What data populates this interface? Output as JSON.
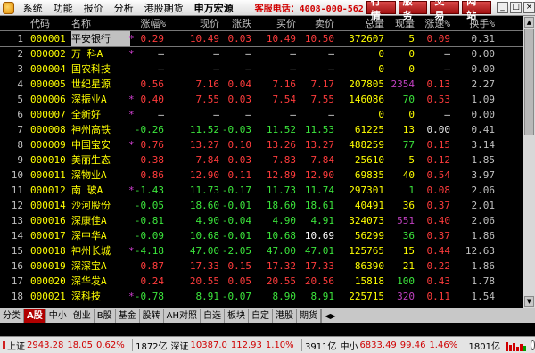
{
  "menubar": {
    "items": [
      "系统",
      "功能",
      "报价",
      "分析",
      "港股期货",
      "申万宏源"
    ],
    "hotline": "客服电话：4008-000-562",
    "buttons": [
      "行 情",
      "服 务",
      "交 易",
      "网 站"
    ]
  },
  "table": {
    "headers": [
      "代码",
      "名称",
      "涨幅%",
      "现价",
      "涨跌",
      "买价",
      "卖价",
      "总量",
      "现量",
      "涨速%",
      "换手%"
    ],
    "rows": [
      {
        "idx": "1",
        "code": "000001",
        "name": "平安银行",
        "star": "*",
        "pct": "0.29",
        "price": "10.49",
        "chg": "0.03",
        "bid": "10.49",
        "ask": "10.50",
        "vol": "372607",
        "cur": "5",
        "spd": "0.09",
        "turn": "0.31"
      },
      {
        "idx": "2",
        "code": "000002",
        "name": "万  科A",
        "star": "*",
        "pct": "—",
        "price": "—",
        "chg": "—",
        "bid": "—",
        "ask": "—",
        "vol": "0",
        "cur": "0",
        "spd": "—",
        "turn": "0.00"
      },
      {
        "idx": "3",
        "code": "000004",
        "name": "国农科技",
        "star": "",
        "pct": "—",
        "price": "—",
        "chg": "—",
        "bid": "—",
        "ask": "—",
        "vol": "0",
        "cur": "0",
        "spd": "—",
        "turn": "0.00"
      },
      {
        "idx": "4",
        "code": "000005",
        "name": "世纪星源",
        "star": "",
        "pct": "0.56",
        "price": "7.16",
        "chg": "0.04",
        "bid": "7.16",
        "ask": "7.17",
        "vol": "207805",
        "cur": "2354",
        "spd": "0.13",
        "turn": "2.27"
      },
      {
        "idx": "5",
        "code": "000006",
        "name": "深振业A",
        "star": "*",
        "pct": "0.40",
        "price": "7.55",
        "chg": "0.03",
        "bid": "7.54",
        "ask": "7.55",
        "vol": "146086",
        "cur": "70",
        "spd": "0.53",
        "turn": "1.09"
      },
      {
        "idx": "6",
        "code": "000007",
        "name": "全新好",
        "star": "*",
        "pct": "—",
        "price": "—",
        "chg": "—",
        "bid": "—",
        "ask": "—",
        "vol": "0",
        "cur": "0",
        "spd": "—",
        "turn": "0.00"
      },
      {
        "idx": "7",
        "code": "000008",
        "name": "神州高铁",
        "star": "",
        "pct": "-0.26",
        "price": "11.52",
        "chg": "-0.03",
        "bid": "11.52",
        "ask": "11.53",
        "vol": "61225",
        "cur": "13",
        "spd": "0.00",
        "turn": "0.41"
      },
      {
        "idx": "8",
        "code": "000009",
        "name": "中国宝安",
        "star": "*",
        "pct": "0.76",
        "price": "13.27",
        "chg": "0.10",
        "bid": "13.26",
        "ask": "13.27",
        "vol": "488259",
        "cur": "77",
        "spd": "0.15",
        "turn": "3.14"
      },
      {
        "idx": "9",
        "code": "000010",
        "name": "美丽生态",
        "star": "",
        "pct": "0.38",
        "price": "7.84",
        "chg": "0.03",
        "bid": "7.83",
        "ask": "7.84",
        "vol": "25610",
        "cur": "5",
        "spd": "0.12",
        "turn": "1.85"
      },
      {
        "idx": "10",
        "code": "000011",
        "name": "深物业A",
        "star": "",
        "pct": "0.86",
        "price": "12.90",
        "chg": "0.11",
        "bid": "12.89",
        "ask": "12.90",
        "vol": "69835",
        "cur": "40",
        "spd": "0.54",
        "turn": "3.97"
      },
      {
        "idx": "11",
        "code": "000012",
        "name": "南  玻A",
        "star": "*",
        "pct": "-1.43",
        "price": "11.73",
        "chg": "-0.17",
        "bid": "11.73",
        "ask": "11.74",
        "vol": "297301",
        "cur": "1",
        "spd": "0.08",
        "turn": "2.06"
      },
      {
        "idx": "12",
        "code": "000014",
        "name": "沙河股份",
        "star": "",
        "pct": "-0.05",
        "price": "18.60",
        "chg": "-0.01",
        "bid": "18.60",
        "ask": "18.61",
        "vol": "40491",
        "cur": "36",
        "spd": "0.37",
        "turn": "2.01"
      },
      {
        "idx": "13",
        "code": "000016",
        "name": "深康佳A",
        "star": "",
        "pct": "-0.81",
        "price": "4.90",
        "chg": "-0.04",
        "bid": "4.90",
        "ask": "4.91",
        "vol": "324073",
        "cur": "551",
        "spd": "0.40",
        "turn": "2.06"
      },
      {
        "idx": "14",
        "code": "000017",
        "name": "深中华A",
        "star": "",
        "pct": "-0.09",
        "price": "10.68",
        "chg": "-0.01",
        "bid": "10.68",
        "ask": "10.69",
        "vol": "56299",
        "cur": "36",
        "spd": "0.37",
        "turn": "1.86"
      },
      {
        "idx": "15",
        "code": "000018",
        "name": "神州长城",
        "star": "*",
        "pct": "-4.18",
        "price": "47.00",
        "chg": "-2.05",
        "bid": "47.00",
        "ask": "47.01",
        "vol": "125765",
        "cur": "15",
        "spd": "0.44",
        "turn": "12.63"
      },
      {
        "idx": "16",
        "code": "000019",
        "name": "深深宝A",
        "star": "",
        "pct": "0.87",
        "price": "17.33",
        "chg": "0.15",
        "bid": "17.32",
        "ask": "17.33",
        "vol": "86390",
        "cur": "21",
        "spd": "0.22",
        "turn": "1.86"
      },
      {
        "idx": "17",
        "code": "000020",
        "name": "深华发A",
        "star": "",
        "pct": "0.24",
        "price": "20.55",
        "chg": "0.05",
        "bid": "20.55",
        "ask": "20.56",
        "vol": "15818",
        "cur": "100",
        "spd": "0.43",
        "turn": "1.78"
      },
      {
        "idx": "18",
        "code": "000021",
        "name": "深科技",
        "star": "*",
        "pct": "-0.78",
        "price": "8.91",
        "chg": "-0.07",
        "bid": "8.90",
        "ask": "8.91",
        "vol": "225715",
        "cur": "320",
        "spd": "0.11",
        "turn": "1.54"
      }
    ]
  },
  "tabs": [
    "分类",
    "A股",
    "中小",
    "创业",
    "B股",
    "基金",
    "股转",
    "AH对照",
    "自选",
    "板块",
    "自定",
    "港股",
    "期货"
  ],
  "active_tab": "A股",
  "status": {
    "sh_name": "上证",
    "sh_value": "2943.28",
    "sh_change": "18.05",
    "sh_pct": "0.62%",
    "sh_amount": "1872亿",
    "sz_name": "深证",
    "sz_value": "10387.0",
    "sz_change": "112.93",
    "sz_pct": "1.10%",
    "sz_amount": "3911亿",
    "zx_name": "中小",
    "zx_value": "6833.49",
    "zx_change": "99.46",
    "zx_pct": "1.46%",
    "zx_amount": "1801亿"
  },
  "colors": {
    "up": "#ff3c3c",
    "down": "#3ce63c",
    "flat": "#e8e8e8",
    "code": "#ffff00",
    "active_tab": "#b00000"
  }
}
